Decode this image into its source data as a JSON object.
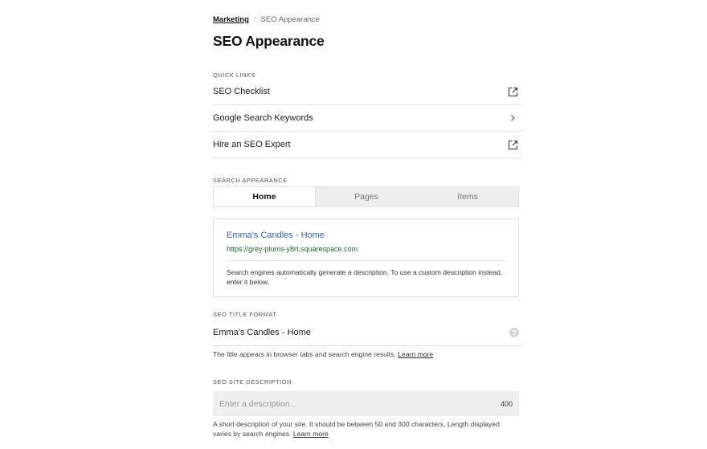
{
  "breadcrumb": {
    "parent": "Marketing",
    "separator": "/",
    "current": "SEO Appearance"
  },
  "page_title": "SEO Appearance",
  "quick_links": {
    "label": "QUICK LINKS",
    "items": [
      {
        "label": "SEO Checklist",
        "icon": "external-link-icon"
      },
      {
        "label": "Google Search Keywords",
        "icon": "chevron-right-icon"
      },
      {
        "label": "Hire an SEO Expert",
        "icon": "external-link-icon"
      }
    ]
  },
  "search_appearance": {
    "label": "SEARCH APPEARANCE",
    "tabs": [
      "Home",
      "Pages",
      "Items"
    ],
    "active_tab": "Home",
    "preview": {
      "title": "Emma's Candles - Home",
      "url": "https://grey-plums-y8rt.squarespace.com",
      "description": "Search engines automatically generate a description. To use a custom description instead, enter it below."
    }
  },
  "seo_title_format": {
    "label": "SEO TITLE FORMAT",
    "value": "Emma's Candles - Home",
    "help_icon": "?",
    "hint": "The title appears in browser tabs and search engine results.",
    "hint_link": "Learn more"
  },
  "seo_site_description": {
    "label": "SEO SITE DESCRIPTION",
    "placeholder": "Enter a description...",
    "counter": "400",
    "hint": "A short description of your site. It should be between 50 and 300 characters. Length displayed varies by search engines.",
    "hint_link": "Learn more"
  },
  "colors": {
    "link_blue": "#2f5fd0",
    "url_green": "#1f6d2c",
    "tab_bg": "#ededed",
    "input_bg": "#efefef"
  }
}
